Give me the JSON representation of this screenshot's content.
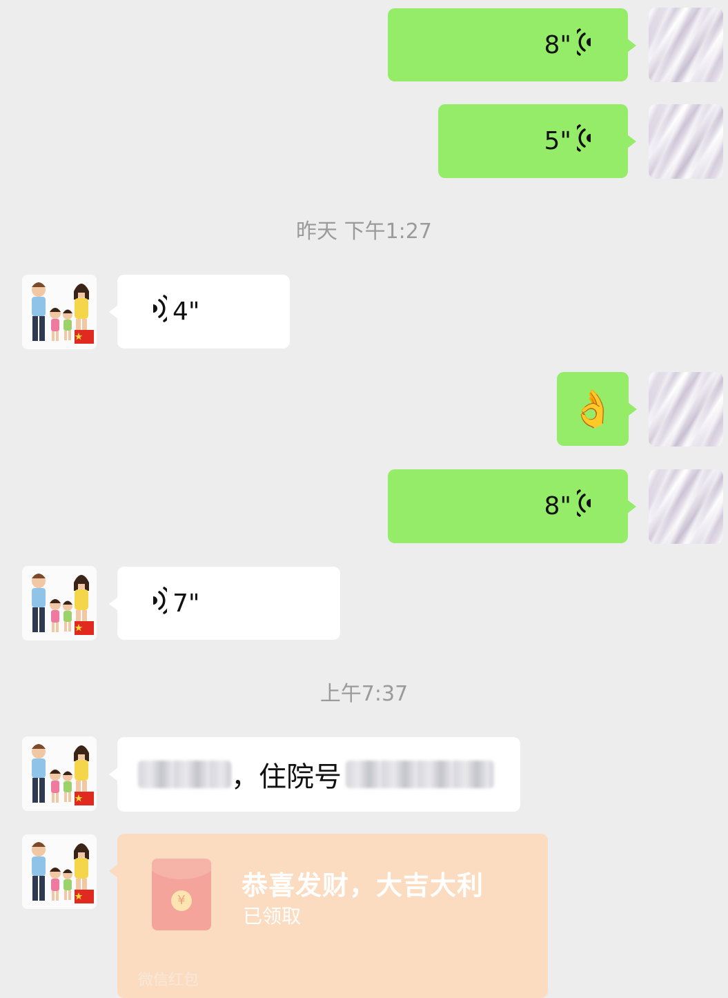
{
  "chat": {
    "messages": [
      {
        "side": "out",
        "type": "voice",
        "duration": "8\""
      },
      {
        "side": "out",
        "type": "voice",
        "duration": "5\""
      },
      {
        "side": "in",
        "type": "voice",
        "duration": "4\""
      },
      {
        "side": "out",
        "type": "emoji",
        "emoji": "👌"
      },
      {
        "side": "out",
        "type": "voice",
        "duration": "8\""
      },
      {
        "side": "in",
        "type": "voice",
        "duration": "7\""
      },
      {
        "side": "in",
        "type": "text",
        "text_visible": "，住院号"
      },
      {
        "side": "in",
        "type": "red_packet",
        "title": "恭喜发财，大吉大利",
        "status": "已领取",
        "footer": "微信红包"
      }
    ],
    "timestamps": [
      "昨天 下午1:27",
      "上午7:37"
    ]
  },
  "colors": {
    "background": "#ededed",
    "outgoing_bubble": "#95ec69",
    "incoming_bubble": "#ffffff",
    "red_packet_opened": "#fbdcc0",
    "timestamp_text": "#9a9a9a"
  },
  "icons": {
    "voice_outgoing": "voice-wave-icon",
    "voice_incoming": "voice-wave-icon",
    "red_envelope": "red-envelope-icon"
  }
}
